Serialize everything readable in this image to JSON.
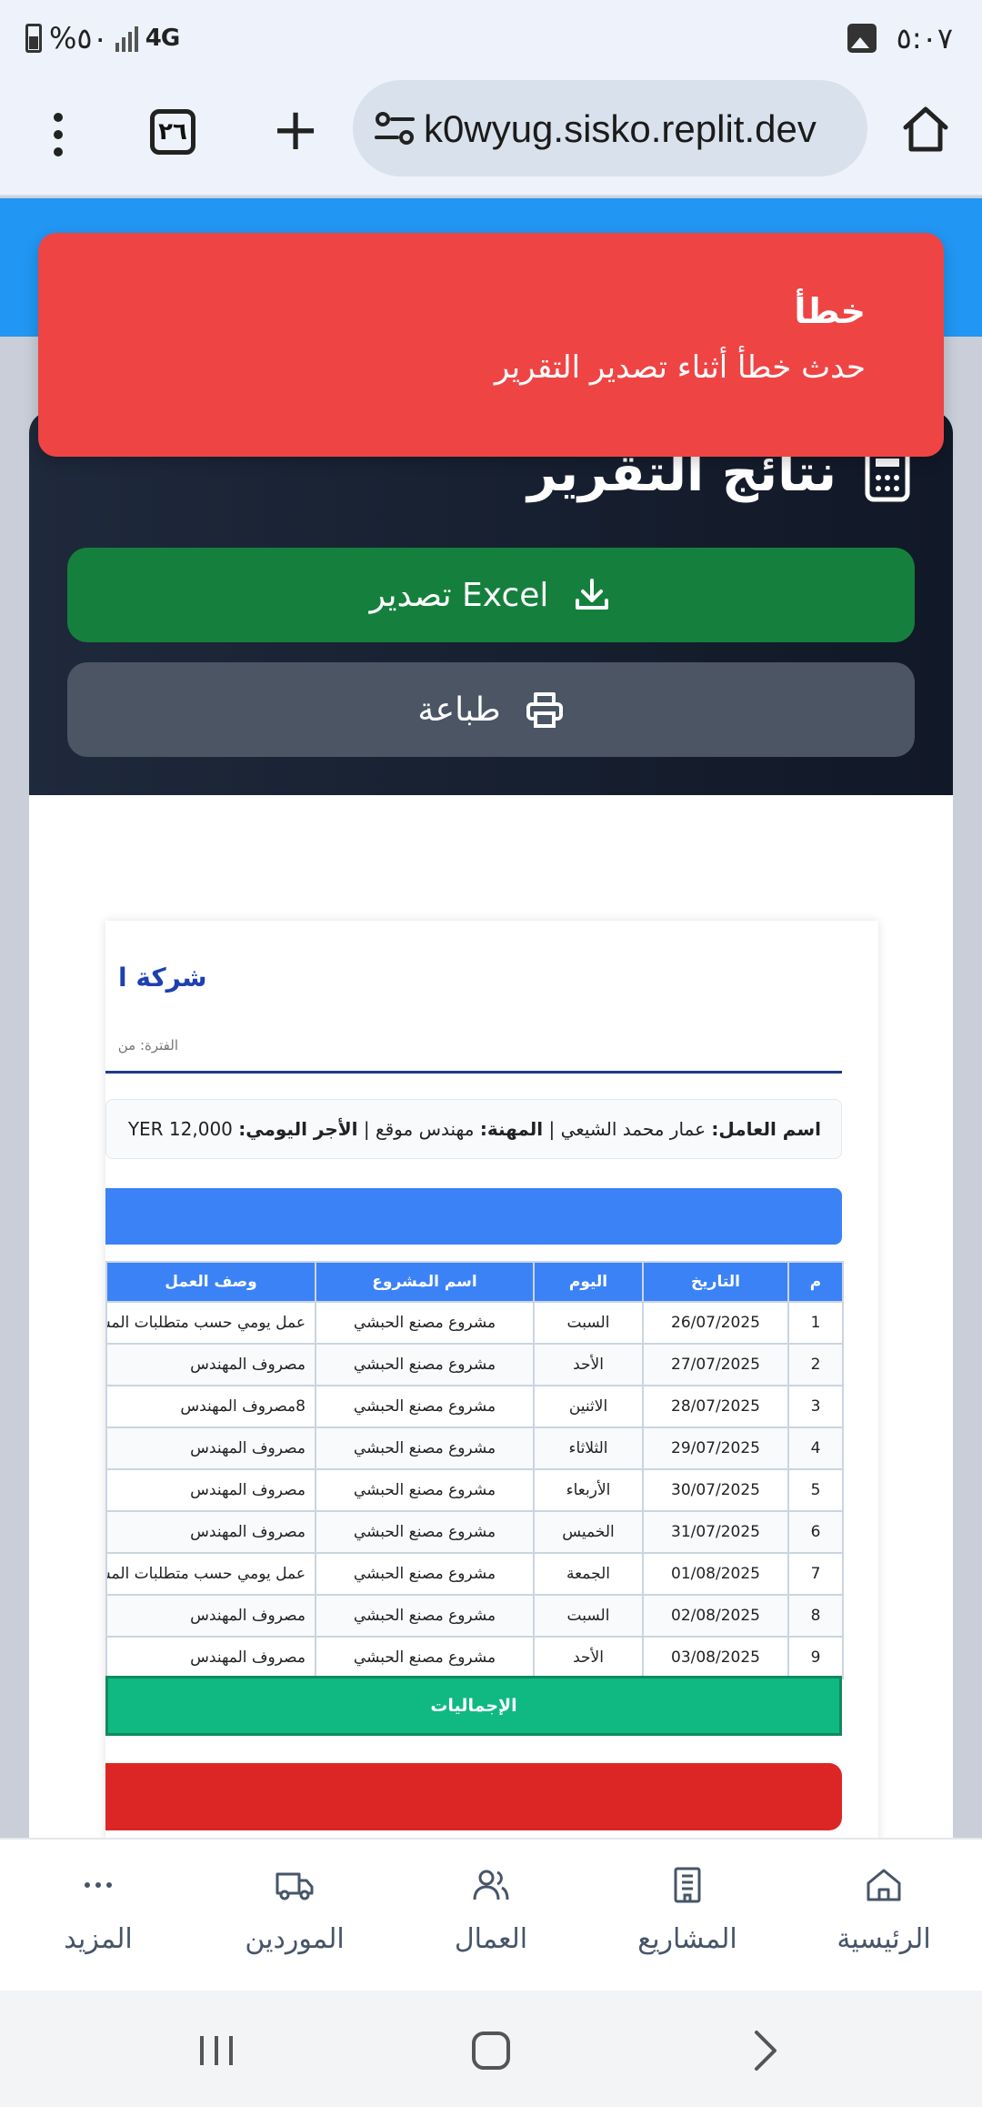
{
  "status_bar": {
    "battery": "%٥٠",
    "network": "4G",
    "time": "٥:٠٧"
  },
  "browser": {
    "tab_count": "٢٦",
    "url": "k0wyug.sisko.replit.dev",
    "icons": [
      "menu-dots-icon",
      "tabs-icon",
      "plus-icon",
      "site-settings-icon",
      "home-icon"
    ]
  },
  "results": {
    "title": "نتائج التقرير",
    "excel_button": "تصدير Excel",
    "print_button": "طباعة"
  },
  "report": {
    "company_name": "شركة ا",
    "period_label": "الفترة: من",
    "worker_label": "اسم العامل:",
    "worker_name": "عمار محمد الشيعي",
    "profession_label": "المهنة:",
    "profession": "مهندس موقع",
    "daily_wage_label": "الأجر اليومي:",
    "daily_wage": "YER 12,000",
    "columns": [
      "م",
      "التاريخ",
      "اليوم",
      "اسم المشروع",
      "وصف العمل"
    ],
    "rows": [
      [
        "1",
        "26/07/2025",
        "السبت",
        "مشروع مصنع الحبشي",
        "عمل يومي حسب متطلبات المشروع"
      ],
      [
        "2",
        "27/07/2025",
        "الأحد",
        "مشروع مصنع الحبشي",
        "مصروف المهندس"
      ],
      [
        "3",
        "28/07/2025",
        "الاثنين",
        "مشروع مصنع الحبشي",
        "8مصروف المهندس"
      ],
      [
        "4",
        "29/07/2025",
        "الثلاثاء",
        "مشروع مصنع الحبشي",
        "مصروف المهندس"
      ],
      [
        "5",
        "30/07/2025",
        "الأربعاء",
        "مشروع مصنع الحبشي",
        "مصروف المهندس"
      ],
      [
        "6",
        "31/07/2025",
        "الخميس",
        "مشروع مصنع الحبشي",
        "مصروف المهندس"
      ],
      [
        "7",
        "01/08/2025",
        "الجمعة",
        "مشروع مصنع الحبشي",
        "عمل يومي حسب متطلبات المشروع"
      ],
      [
        "8",
        "02/08/2025",
        "السبت",
        "مشروع مصنع الحبشي",
        "مصروف المهندس"
      ],
      [
        "9",
        "03/08/2025",
        "الأحد",
        "مشروع مصنع الحبشي",
        "مصروف المهندس"
      ]
    ],
    "totals_label": "الإجماليات"
  },
  "toast": {
    "title": "خطأ",
    "message": "حدث خطأ أثناء تصدير التقرير",
    "color": "#ef4444"
  },
  "bottom_nav": {
    "items": [
      {
        "label": "الرئيسية",
        "icon": "home-icon"
      },
      {
        "label": "المشاريع",
        "icon": "building-icon"
      },
      {
        "label": "العمال",
        "icon": "users-icon"
      },
      {
        "label": "الموردين",
        "icon": "truck-icon"
      },
      {
        "label": "المزيد",
        "icon": "more-icon"
      }
    ]
  },
  "colors": {
    "header_blue": "#2196f3",
    "excel_green": "#15803d",
    "print_gray": "#4b5563",
    "table_blue": "#3b82f6",
    "totals_green": "#10b981",
    "red_bar": "#dc2626"
  }
}
